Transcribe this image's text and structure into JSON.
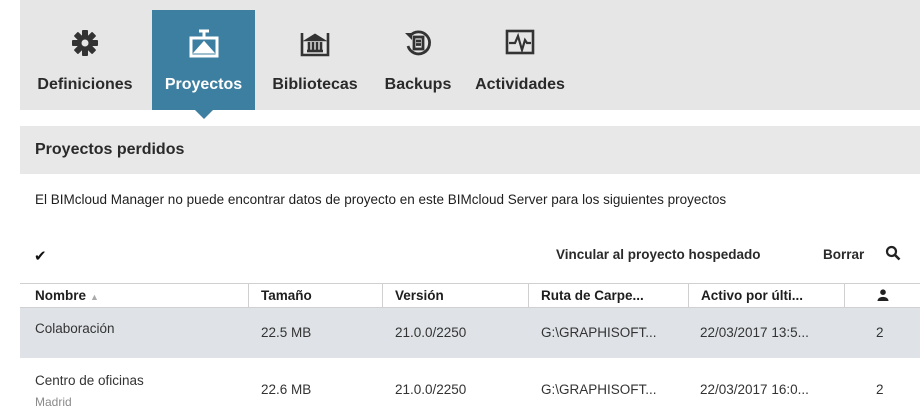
{
  "nav": {
    "tabs": [
      {
        "label": "Definiciones",
        "icon": "gear-icon"
      },
      {
        "label": "Proyectos",
        "icon": "projects-icon",
        "active": true
      },
      {
        "label": "Bibliotecas",
        "icon": "library-icon"
      },
      {
        "label": "Backups",
        "icon": "backup-icon"
      },
      {
        "label": "Actividades",
        "icon": "activity-icon"
      }
    ]
  },
  "section": {
    "title": "Proyectos perdidos"
  },
  "description": "El BIMcloud Manager  no puede encontrar datos de proyecto en este  BIMcloud Server para los siguientes proyectos",
  "toolbar": {
    "link_label": "Vincular al proyecto hospedado",
    "delete_label": "Borrar"
  },
  "table": {
    "columns": [
      "Nombre",
      "Tamaño",
      "Versión",
      "Ruta de Carpe...",
      "Activo por últi..."
    ],
    "rows": [
      {
        "name": "Colaboración",
        "subtitle": "",
        "size": "22.5 MB",
        "version": "21.0.0/2250",
        "path": "G:\\GRAPHISOFT...",
        "active": "22/03/2017 13:5...",
        "users": "2"
      },
      {
        "name": "Centro de oficinas",
        "subtitle": "Madrid",
        "size": "22.6 MB",
        "version": "21.0.0/2250",
        "path": "G:\\GRAPHISOFT...",
        "active": "22/03/2017 16:0...",
        "users": "2"
      }
    ]
  },
  "colors": {
    "accent": "#3d7fa0",
    "nav_bg": "#e6e6e6",
    "selected_row": "#dfe3e7"
  }
}
